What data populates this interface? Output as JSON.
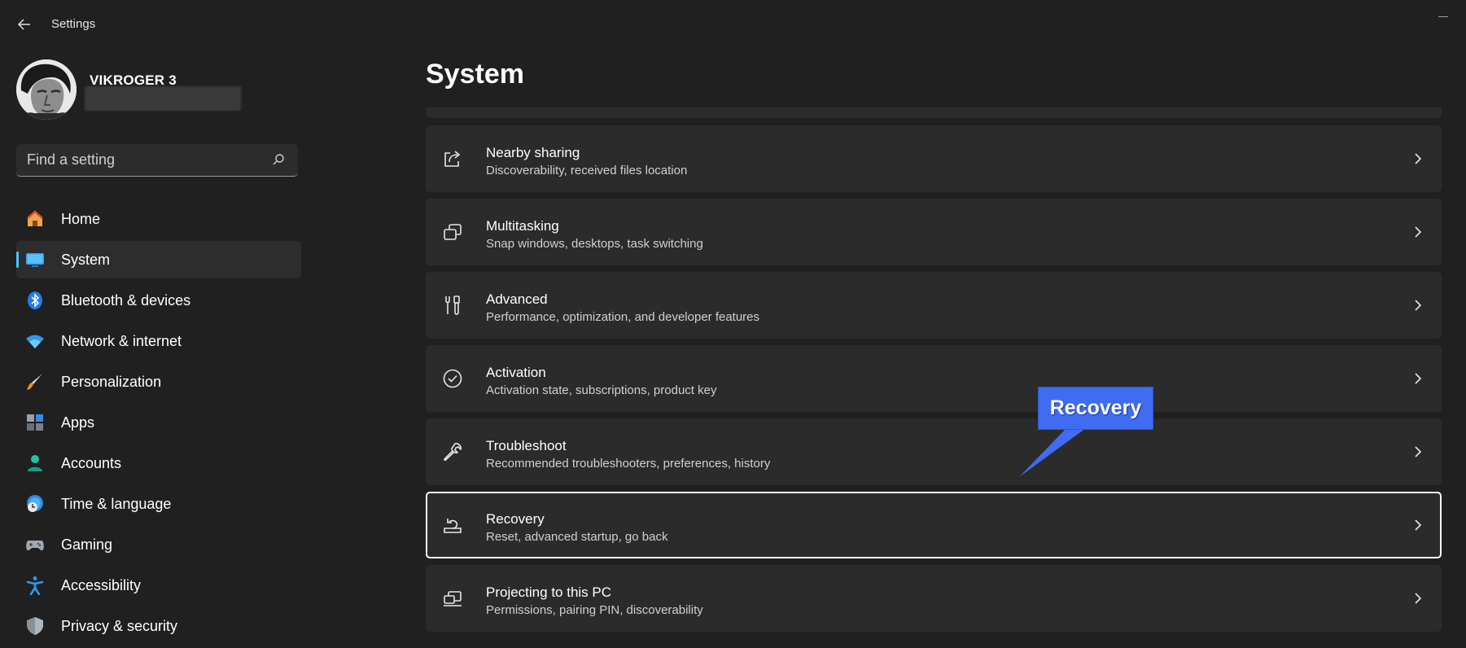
{
  "window": {
    "title": "Settings"
  },
  "profile": {
    "name": "VIKROGER 3"
  },
  "search": {
    "placeholder": "Find a setting"
  },
  "sidebar": {
    "items": [
      {
        "label": "Home",
        "icon": "home-icon"
      },
      {
        "label": "System",
        "icon": "system-display-icon",
        "selected": true
      },
      {
        "label": "Bluetooth & devices",
        "icon": "bluetooth-icon"
      },
      {
        "label": "Network & internet",
        "icon": "wifi-icon"
      },
      {
        "label": "Personalization",
        "icon": "brush-icon"
      },
      {
        "label": "Apps",
        "icon": "apps-icon"
      },
      {
        "label": "Accounts",
        "icon": "person-icon"
      },
      {
        "label": "Time & language",
        "icon": "globe-clock-icon"
      },
      {
        "label": "Gaming",
        "icon": "gamepad-icon"
      },
      {
        "label": "Accessibility",
        "icon": "accessibility-icon"
      },
      {
        "label": "Privacy & security",
        "icon": "shield-icon"
      }
    ]
  },
  "main": {
    "title": "System",
    "cards": [
      {
        "title": "Nearby sharing",
        "subtitle": "Discoverability, received files location",
        "icon": "share-icon"
      },
      {
        "title": "Multitasking",
        "subtitle": "Snap windows, desktops, task switching",
        "icon": "multitasking-icon"
      },
      {
        "title": "Advanced",
        "subtitle": "Performance, optimization, and developer features",
        "icon": "tools-icon"
      },
      {
        "title": "Activation",
        "subtitle": "Activation state, subscriptions, product key",
        "icon": "check-circle-icon"
      },
      {
        "title": "Troubleshoot",
        "subtitle": "Recommended troubleshooters, preferences, history",
        "icon": "wrench-icon"
      },
      {
        "title": "Recovery",
        "subtitle": "Reset, advanced startup, go back",
        "icon": "recovery-icon",
        "highlighted": true
      },
      {
        "title": "Projecting to this PC",
        "subtitle": "Permissions, pairing PIN, discoverability",
        "icon": "projecting-icon"
      }
    ]
  },
  "callout": {
    "label": "Recovery",
    "color": "#3f6cf0"
  },
  "colors": {
    "background": "#202020",
    "card": "#2b2b2b",
    "accent": "#4cc2ff"
  }
}
